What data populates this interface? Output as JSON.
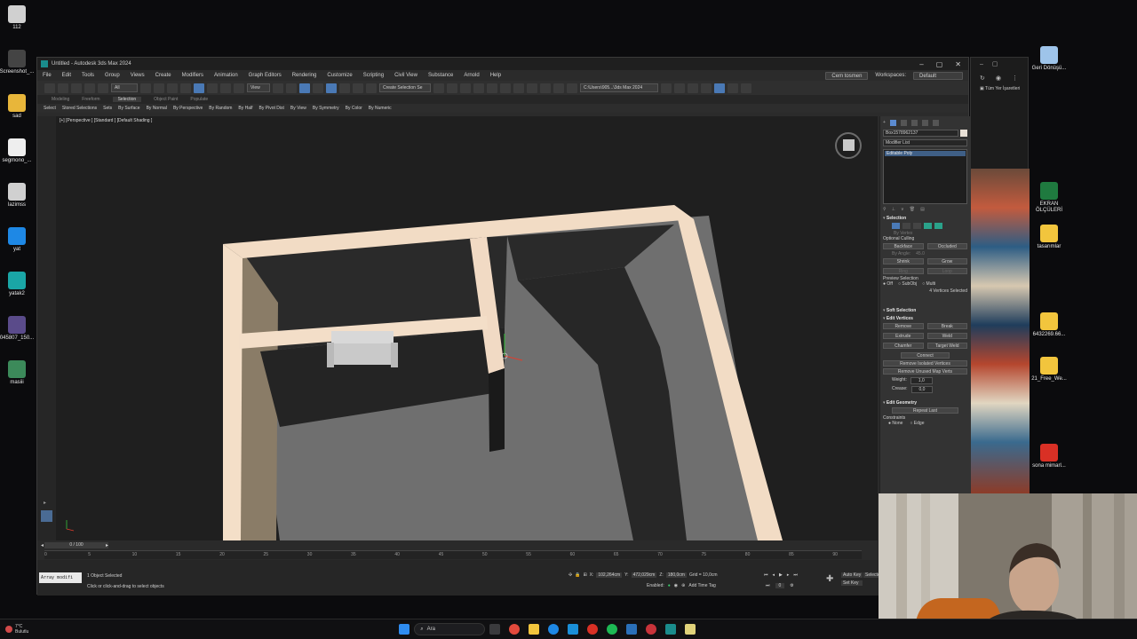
{
  "desktop": {
    "left_icons": [
      {
        "label": "112",
        "color": "#d0d0d0"
      },
      {
        "label": "Screenshot_...",
        "color": "#444"
      },
      {
        "label": "sad",
        "color": "#e8b63a"
      },
      {
        "label": "segmono_...",
        "color": "#eeeeee"
      },
      {
        "label": "lazimss",
        "color": "#d0d0d0"
      },
      {
        "label": "yat",
        "color": "#1e88e5"
      },
      {
        "label": "yatak2",
        "color": "#1aa6a6"
      },
      {
        "label": "045807_150...",
        "color": "#5a4b8a"
      },
      {
        "label": "masiii",
        "color": "#3c8a5a"
      }
    ],
    "right_icons": [
      {
        "label": "Geri Dönüşü...",
        "color": "#9ec4ea"
      },
      {
        "label": "EKRAN ÖLÇÜLERİ",
        "color": "#1f7a3f"
      },
      {
        "label": "tasarımlar",
        "color": "#f2c53d"
      },
      {
        "label": "6432269.66...",
        "color": "#f2c53d"
      },
      {
        "label": "21_Free_We...",
        "color": "#f2c53d"
      },
      {
        "label": "sona mimarl...",
        "color": "#d93025"
      }
    ]
  },
  "window": {
    "title": "Untitled - Autodesk 3ds Max 2024",
    "menu": [
      "File",
      "Edit",
      "Tools",
      "Group",
      "Views",
      "Create",
      "Modifiers",
      "Animation",
      "Graph Editors",
      "Rendering",
      "Customize",
      "Scripting",
      "Civil View",
      "Substance",
      "Arnold",
      "Help"
    ],
    "user": "Cem tosmen",
    "workspaces_label": "Workspaces:",
    "workspace_value": "Default",
    "toolbar_filter": "All",
    "toolbar_view": "View",
    "selection_set": "Create Selection Se",
    "path": "C:\\Users\\905...\\3ds Max 2024",
    "ribbon_tabs": [
      "Modeling",
      "Freeform",
      "Selection",
      "Object Paint",
      "Populate"
    ],
    "ribbon_active": "Selection",
    "ribbon_items": [
      "Select",
      "Stored Selections",
      "Sets",
      "By Surface",
      "By Normal",
      "By Perspective",
      "By Random",
      "By Half",
      "By Pivot Dist",
      "By View",
      "By Symmetry",
      "By Color",
      "By Numeric"
    ],
    "viewport_label": "[+] [Perspective ] [Standard ] [Default Shading ]"
  },
  "command_panel": {
    "object_name": "Box1578962137",
    "modifier_list": "Modifier List",
    "modifier_item": "Editable Poly",
    "selection_title": "Selection",
    "by_vertex": "By Vertex",
    "ignore_backfacing": "Ignore Backfacing",
    "optional_culling": "Optional Culling",
    "backface": "Backface",
    "occluded": "Occluded",
    "by_angle": "By Angle:",
    "angle_value": "45.0",
    "shrink": "Shrink",
    "grow": "Grow",
    "ring": "Ring",
    "loop": "Loop",
    "preview_selection": "Preview Selection",
    "off": "Off",
    "subobj": "SubObj",
    "multi": "Multi",
    "status": "4 Vertices Selected",
    "soft_selection": "Soft Selection",
    "edit_vertices": "Edit Vertices",
    "remove": "Remove",
    "break": "Break",
    "extrude": "Extrude",
    "weld": "Weld",
    "chamfer": "Chamfer",
    "target_weld": "Target Weld",
    "connect": "Connect",
    "remove_isolated": "Remove Isolated Vertices",
    "remove_unused": "Remove Unused Map Verts",
    "weight_label": "Weight:",
    "weight_value": "1,0",
    "crease_label": "Crease:",
    "crease_value": "0,0",
    "edit_geometry": "Edit Geometry",
    "repeat_last": "Repeat Last",
    "constraints": "Constraints",
    "none": "None",
    "edge": "Edge"
  },
  "timeline": {
    "frame": "0 / 100",
    "ticks": [
      "0",
      "5",
      "10",
      "15",
      "20",
      "25",
      "30",
      "35",
      "40",
      "45",
      "50",
      "55",
      "60",
      "65",
      "70",
      "75",
      "80",
      "85",
      "90"
    ]
  },
  "status_bar": {
    "script_box": "Array modifi",
    "objects_selected": "1 Object Selected",
    "prompt": "Click or click-and-drag to select objects",
    "x_label": "X:",
    "x_value": "102,264cm",
    "y_label": "Y:",
    "y_value": "472,029cm",
    "z_label": "Z:",
    "z_value": "180,0cm",
    "grid": "Grid = 10,0cm",
    "enabled": "Enabled:",
    "add_time_tag": "Add Time Tag",
    "auto_key": "Auto Key",
    "set_key": "Set Key",
    "selected": "Selecte",
    "key_filters": "0"
  },
  "right_app": {
    "label": "Tüm Yer İşaretleri"
  },
  "taskbar": {
    "weather_temp": "7°C",
    "weather_label": "Bulutlu",
    "search": "Ara"
  }
}
